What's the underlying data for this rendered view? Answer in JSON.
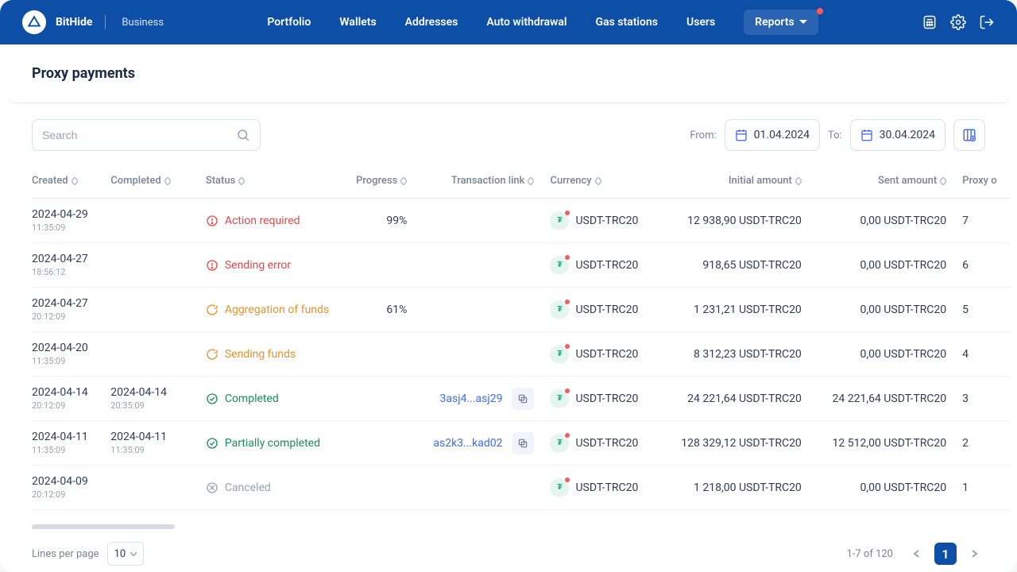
{
  "brand": {
    "name": "BitHide",
    "sub": "Business"
  },
  "nav": {
    "items": [
      {
        "label": "Portfolio"
      },
      {
        "label": "Wallets"
      },
      {
        "label": "Addresses"
      },
      {
        "label": "Auto withdrawal"
      },
      {
        "label": "Gas stations"
      },
      {
        "label": "Users"
      },
      {
        "label": "Reports",
        "active": true,
        "dropdown": true,
        "dot": true
      }
    ]
  },
  "page": {
    "title": "Proxy payments"
  },
  "toolbar": {
    "search_placeholder": "Search",
    "from_label": "From:",
    "to_label": "To:",
    "from_date": "01.04.2024",
    "to_date": "30.04.2024"
  },
  "columns": {
    "created": "Created",
    "completed": "Completed",
    "status": "Status",
    "progress": "Progress",
    "tx": "Transaction link",
    "currency": "Currency",
    "initial": "Initial amount",
    "sent": "Sent amount",
    "proxy": "Proxy o"
  },
  "rows": [
    {
      "created_date": "2024-04-29",
      "created_time": "11:35:09",
      "completed_date": "",
      "completed_time": "",
      "status_key": "action-required",
      "status_label": "Action required",
      "progress": "99%",
      "tx": "",
      "currency": "USDT-TRC20",
      "initial": "12 938,90 USDT-TRC20",
      "sent": "0,00 USDT-TRC20",
      "proxy": "7"
    },
    {
      "created_date": "2024-04-27",
      "created_time": "18:56:12",
      "completed_date": "",
      "completed_time": "",
      "status_key": "sending-error",
      "status_label": "Sending error",
      "progress": "",
      "tx": "",
      "currency": "USDT-TRC20",
      "initial": "918,65 USDT-TRC20",
      "sent": "0,00 USDT-TRC20",
      "proxy": "6"
    },
    {
      "created_date": "2024-04-27",
      "created_time": "20:12:09",
      "completed_date": "",
      "completed_time": "",
      "status_key": "aggregation",
      "status_label": "Aggregation of funds",
      "progress": "61%",
      "tx": "",
      "currency": "USDT-TRC20",
      "initial": "1 231,21 USDT-TRC20",
      "sent": "0,00 USDT-TRC20",
      "proxy": "5"
    },
    {
      "created_date": "2024-04-20",
      "created_time": "11:35:09",
      "completed_date": "",
      "completed_time": "",
      "status_key": "sending-funds",
      "status_label": "Sending funds",
      "progress": "",
      "tx": "",
      "currency": "USDT-TRC20",
      "initial": "8 312,23 USDT-TRC20",
      "sent": "0,00 USDT-TRC20",
      "proxy": "4"
    },
    {
      "created_date": "2024-04-14",
      "created_time": "20:12:09",
      "completed_date": "2024-04-14",
      "completed_time": "20:35:09",
      "status_key": "completed",
      "status_label": "Completed",
      "progress": "",
      "tx": "3asj4...asj29",
      "currency": "USDT-TRC20",
      "initial": "24 221,64 USDT-TRC20",
      "sent": "24 221,64 USDT-TRC20",
      "proxy": "3"
    },
    {
      "created_date": "2024-04-11",
      "created_time": "11:35:09",
      "completed_date": "2024-04-11",
      "completed_time": "11:35:09",
      "status_key": "partially-completed",
      "status_label": "Partially completed",
      "progress": "",
      "tx": "as2k3...kad02",
      "currency": "USDT-TRC20",
      "initial": "128 329,12 USDT-TRC20",
      "sent": "12 512,00 USDT-TRC20",
      "proxy": "2"
    },
    {
      "created_date": "2024-04-09",
      "created_time": "20:12:09",
      "completed_date": "",
      "completed_time": "",
      "status_key": "canceled",
      "status_label": "Canceled",
      "progress": "",
      "tx": "",
      "currency": "USDT-TRC20",
      "initial": "1 218,00 USDT-TRC20",
      "sent": "0,00 USDT-TRC20",
      "proxy": "1"
    }
  ],
  "pagination": {
    "lines_label": "Lines per page",
    "per_page": "10",
    "range_label": "1-7 of 120",
    "current": "1"
  }
}
